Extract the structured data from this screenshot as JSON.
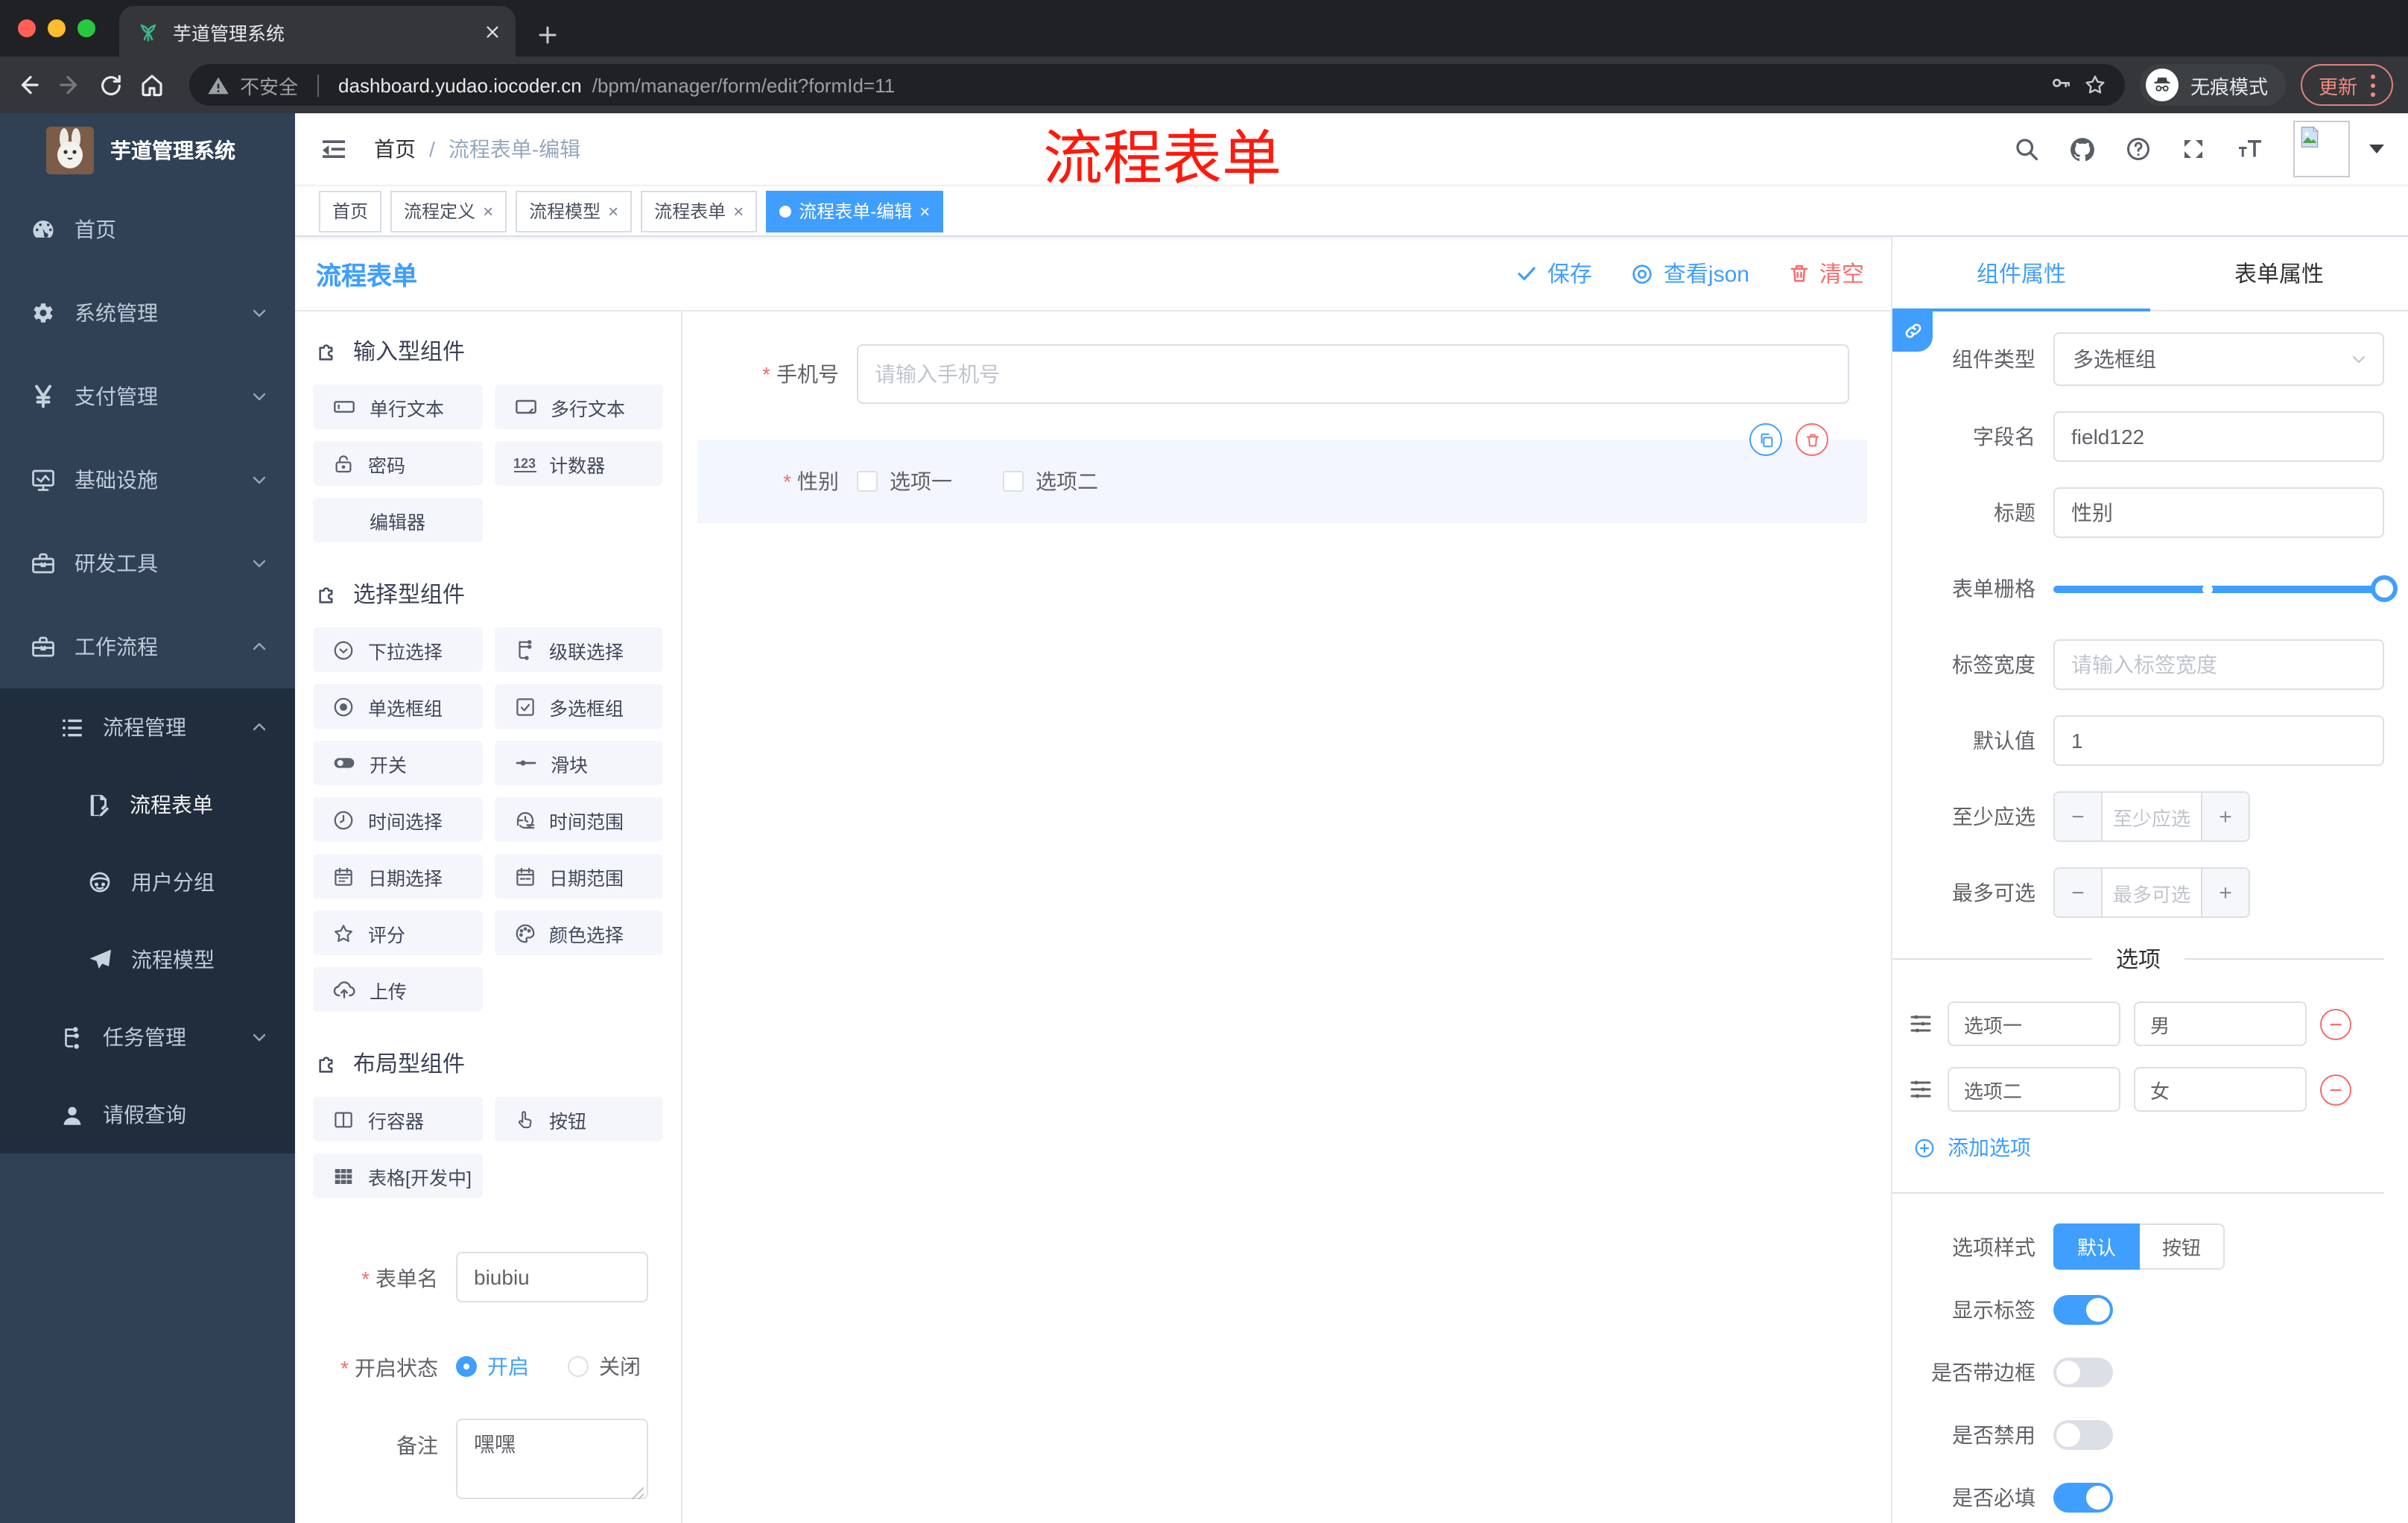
{
  "chrome": {
    "tab_title": "芋道管理系统",
    "url_warning": "不安全",
    "url_domain": "dashboard.yudao.iocoder.cn",
    "url_path": "/bpm/manager/form/edit?formId=11",
    "incognito": "无痕模式",
    "update": "更新"
  },
  "sidebar": {
    "brand": "芋道管理系统",
    "items": [
      {
        "label": "首页"
      },
      {
        "label": "系统管理"
      },
      {
        "label": "支付管理"
      },
      {
        "label": "基础设施"
      },
      {
        "label": "研发工具"
      },
      {
        "label": "工作流程"
      }
    ],
    "submenu": {
      "parent": "流程管理",
      "children": [
        {
          "label": "流程表单"
        },
        {
          "label": "用户分组"
        },
        {
          "label": "流程模型"
        }
      ],
      "siblings": [
        {
          "label": "任务管理"
        },
        {
          "label": "请假查询"
        }
      ]
    }
  },
  "header": {
    "breadcrumb_home": "首页",
    "breadcrumb_current": "流程表单-编辑"
  },
  "annotation": "流程表单",
  "tags": [
    {
      "label": "首页"
    },
    {
      "label": "流程定义"
    },
    {
      "label": "流程模型"
    },
    {
      "label": "流程表单"
    },
    {
      "label": "流程表单-编辑"
    }
  ],
  "designer": {
    "title": "流程表单",
    "save": "保存",
    "view_json": "查看json",
    "clear": "清空"
  },
  "components": {
    "groups": [
      {
        "title": "输入型组件",
        "items": [
          {
            "label": "单行文本"
          },
          {
            "label": "多行文本"
          },
          {
            "label": "密码"
          },
          {
            "label": "计数器"
          },
          {
            "label": "编辑器"
          }
        ]
      },
      {
        "title": "选择型组件",
        "items": [
          {
            "label": "下拉选择"
          },
          {
            "label": "级联选择"
          },
          {
            "label": "单选框组"
          },
          {
            "label": "多选框组"
          },
          {
            "label": "开关"
          },
          {
            "label": "滑块"
          },
          {
            "label": "时间选择"
          },
          {
            "label": "时间范围"
          },
          {
            "label": "日期选择"
          },
          {
            "label": "日期范围"
          },
          {
            "label": "评分"
          },
          {
            "label": "颜色选择"
          },
          {
            "label": "上传"
          }
        ]
      },
      {
        "title": "布局型组件",
        "items": [
          {
            "label": "行容器"
          },
          {
            "label": "按钮"
          },
          {
            "label": "表格[开发中]"
          }
        ]
      }
    ],
    "counter_icon_text": "123"
  },
  "left_form": {
    "name_label": "表单名",
    "name_value": "biubiu",
    "status_label": "开启状态",
    "status_on": "开启",
    "status_off": "关闭",
    "remark_label": "备注",
    "remark_value": "嘿嘿"
  },
  "canvas": {
    "phone_label": "手机号",
    "phone_placeholder": "请输入手机号",
    "gender_label": "性别",
    "gender_options": [
      {
        "label": "选项一"
      },
      {
        "label": "选项二"
      }
    ]
  },
  "props": {
    "tab_component": "组件属性",
    "tab_form": "表单属性",
    "type_label": "组件类型",
    "type_value": "多选框组",
    "field_label": "字段名",
    "field_value": "field122",
    "title_label": "标题",
    "title_value": "性别",
    "grid_label": "表单栅格",
    "labelw_label": "标签宽度",
    "labelw_placeholder": "请输入标签宽度",
    "default_label": "默认值",
    "default_value": "1",
    "min_label": "至少应选",
    "min_placeholder": "至少应选",
    "max_label": "最多可选",
    "max_placeholder": "最多可选",
    "options_title": "选项",
    "options": [
      {
        "label": "选项一",
        "value": "男"
      },
      {
        "label": "选项二",
        "value": "女"
      }
    ],
    "add_option": "添加选项",
    "style_label": "选项样式",
    "style_default": "默认",
    "style_button": "按钮",
    "switch_show_label": "显示标签",
    "switch_border": "是否带边框",
    "switch_disabled": "是否禁用",
    "switch_required": "是否必填"
  }
}
